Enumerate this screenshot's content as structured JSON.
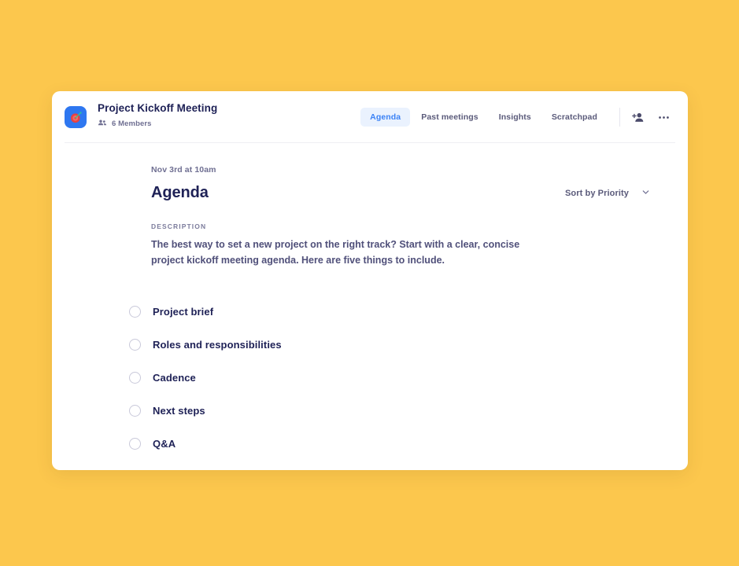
{
  "theme": {
    "page_background": "#FCC74D",
    "card_background": "#FFFFFF",
    "accent_blue": "#3B82F6",
    "active_tab_background": "#EAF2FE",
    "title_color": "#1E2156",
    "muted_text_color": "#6F6F92",
    "app_icon_background": "#2E77F0",
    "app_icon_mark_color": "#E8413F"
  },
  "header": {
    "app_icon_name": "target-icon",
    "workspace_title": "Project Kickoff Meeting",
    "members_icon_name": "people-icon",
    "members_label": "6 Members",
    "tabs": [
      {
        "label": "Agenda",
        "active": true
      },
      {
        "label": "Past meetings",
        "active": false
      },
      {
        "label": "Insights",
        "active": false
      },
      {
        "label": "Scratchpad",
        "active": false
      }
    ],
    "actions": [
      {
        "icon": "add-person-icon"
      },
      {
        "icon": "more-options-icon"
      }
    ]
  },
  "main": {
    "meeting_date": "Nov 3rd at 10am",
    "page_title": "Agenda",
    "sort_label": "Sort by Priority",
    "sort_chevron_icon": "chevron-down-icon",
    "description_label": "DESCRIPTION",
    "description_text": "The best way to set a new project on the right track? Start with a clear, concise project kickoff meeting agenda. Here are five things to include.",
    "agenda_items": [
      {
        "label": "Project brief",
        "checked": false
      },
      {
        "label": "Roles and responsibilities",
        "checked": false
      },
      {
        "label": "Cadence",
        "checked": false
      },
      {
        "label": "Next steps",
        "checked": false
      },
      {
        "label": "Q&A",
        "checked": false
      }
    ]
  }
}
